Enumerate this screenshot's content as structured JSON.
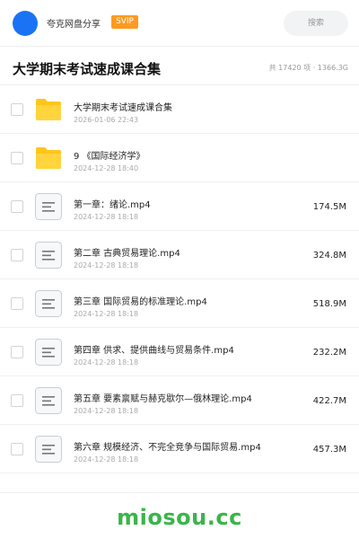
{
  "header": {
    "brand": "夸克网盘分享",
    "badge": "SVIP",
    "search_label": "搜索"
  },
  "folder": {
    "title": "大学期末考试速成课合集",
    "stats": "共 17420 项 · 1366.3G"
  },
  "files": [
    {
      "type": "folder",
      "name": "大学期末考试速成课合集",
      "date": "2026-01-06 22:43",
      "size": ""
    },
    {
      "type": "folder",
      "name": "9 《国际经济学》",
      "date": "2024-12-28 18:40",
      "size": ""
    },
    {
      "type": "file",
      "name": "第一章：绪论.mp4",
      "date": "2024-12-28 18:18",
      "size": "174.5M"
    },
    {
      "type": "file",
      "name": "第二章 古典贸易理论.mp4",
      "date": "2024-12-28 18:18",
      "size": "324.8M"
    },
    {
      "type": "file",
      "name": "第三章 国际贸易的标准理论.mp4",
      "date": "2024-12-28 18:18",
      "size": "518.9M"
    },
    {
      "type": "file",
      "name": "第四章 供求、提供曲线与贸易条件.mp4",
      "date": "2024-12-28 18:18",
      "size": "232.2M"
    },
    {
      "type": "file",
      "name": "第五章 要素禀赋与赫克歇尔—俄林理论.mp4",
      "date": "2024-12-28 18:18",
      "size": "422.7M"
    },
    {
      "type": "file",
      "name": "第六章 规模经济、不完全竞争与国际贸易.mp4",
      "date": "2024-12-28 18:18",
      "size": "457.3M"
    }
  ],
  "watermark": "miosou.cc",
  "colors": {
    "accent": "#1a73f5",
    "badge": "#ff9a1f",
    "folder": "#ffc51a",
    "watermark": "#3ab54a"
  }
}
